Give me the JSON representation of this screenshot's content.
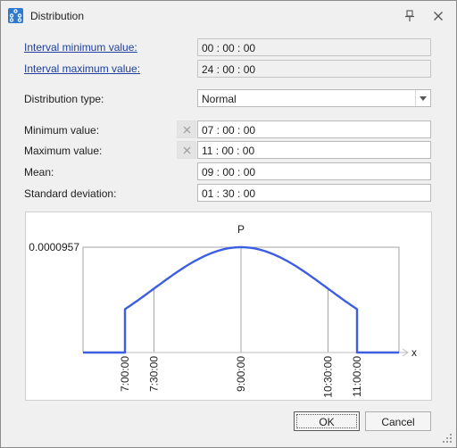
{
  "window": {
    "title": "Distribution",
    "icon": "distribution-app-icon"
  },
  "titlebar_buttons": {
    "pin": "pin-icon",
    "close": "close-icon"
  },
  "form": {
    "interval_min": {
      "label": "Interval minimum value:",
      "value": "00 : 00 : 00"
    },
    "interval_max": {
      "label": "Interval maximum value:",
      "value": "24 : 00 : 00"
    },
    "distribution_type": {
      "label": "Distribution type:",
      "value": "Normal"
    },
    "minimum": {
      "label": "Minimum value:",
      "value": "07 : 00 : 00"
    },
    "maximum": {
      "label": "Maximum value:",
      "value": "11 : 00 : 00"
    },
    "mean": {
      "label": "Mean:",
      "value": "09 : 00 : 00"
    },
    "std_dev": {
      "label": "Standard deviation:",
      "value": "01 : 30 : 00"
    }
  },
  "chart_data": {
    "type": "line",
    "title": "P",
    "xlabel": "x",
    "ylabel": "",
    "y_max_label": "0.0000957",
    "x_ticks": [
      {
        "hours": 7.0,
        "label": "7:00:00"
      },
      {
        "hours": 7.5,
        "label": "7:30:00"
      },
      {
        "hours": 9.0,
        "label": "9:00:00"
      },
      {
        "hours": 10.5,
        "label": "10:30:00"
      },
      {
        "hours": 11.0,
        "label": "11:00:00"
      }
    ],
    "distribution": {
      "kind": "truncated normal",
      "mean_hours": 9,
      "sd_hours": 1.5,
      "min_hours": 7,
      "max_hours": 11,
      "peak_density": 9.57e-05
    },
    "grid": true,
    "colors": {
      "curve": "#3d5ee3",
      "grid": "#a6a6a6",
      "axis": "#bdbdbd"
    }
  },
  "buttons": {
    "ok": "OK",
    "cancel": "Cancel"
  }
}
